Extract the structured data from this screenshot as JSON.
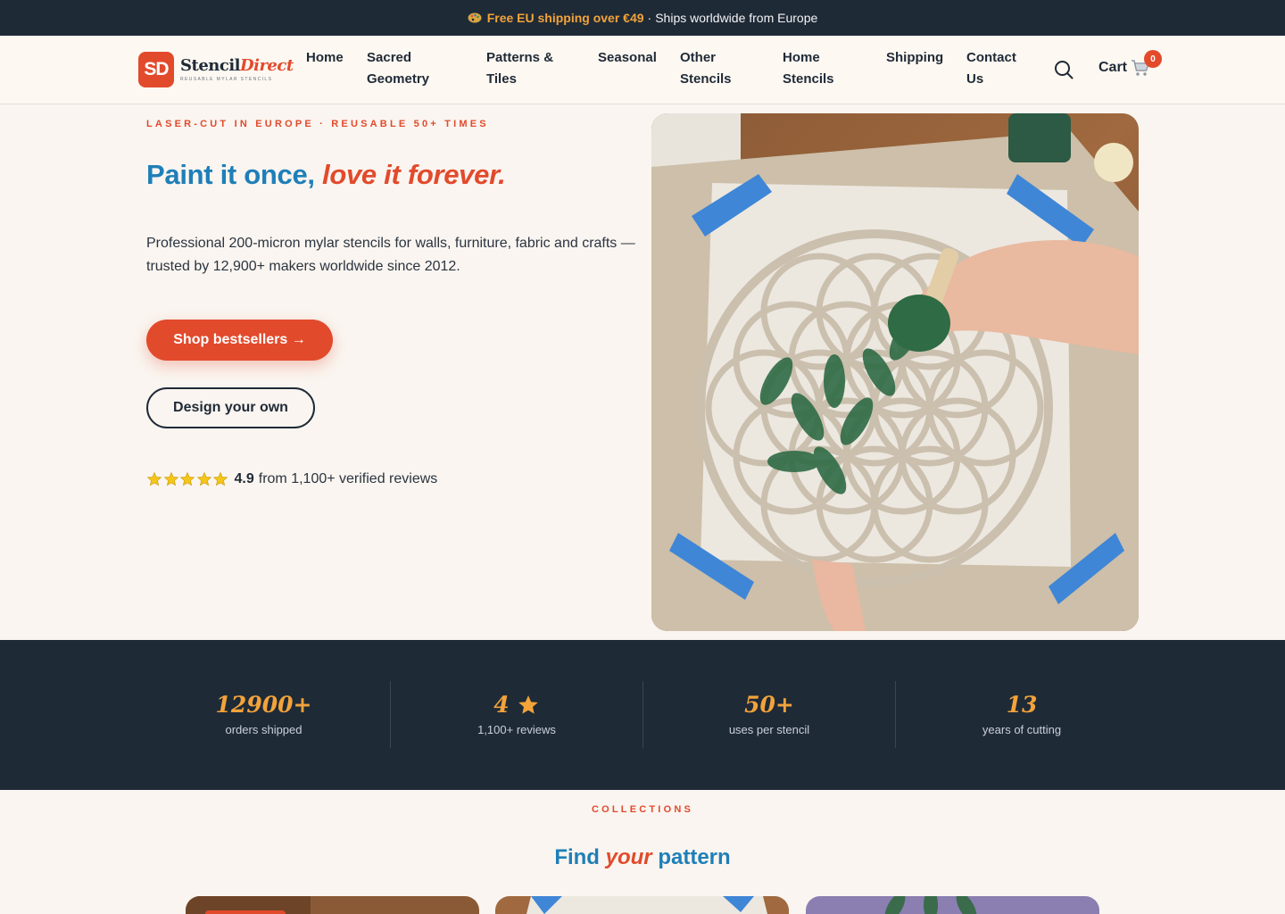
{
  "announcement": {
    "highlight": "Free EU shipping over €49",
    "separator": "·",
    "rest": "Ships worldwide from Europe"
  },
  "brand": {
    "mark": "SD",
    "name_part1": "Stencil",
    "name_part2": "Direct",
    "tagline": "Reusable Mylar Stencils",
    "accent_color": "#e24a2c",
    "blue_color": "#1f7fb8",
    "dark_color": "#1f2a37",
    "gold_color": "#f2a33a"
  },
  "nav": {
    "items": [
      {
        "line1": "Home",
        "line2": ""
      },
      {
        "line1": "Sacred",
        "line2": "Geometry"
      },
      {
        "line1": "Patterns &",
        "line2": "Tiles"
      },
      {
        "line1": "Seasonal",
        "line2": ""
      },
      {
        "line1": "Other",
        "line2": "Stencils"
      },
      {
        "line1": "Home",
        "line2": "Stencils"
      },
      {
        "line1": "Shipping",
        "line2": ""
      },
      {
        "line1": "Contact",
        "line2": "Us"
      }
    ],
    "cart_label": "Cart",
    "cart_count": "0"
  },
  "hero": {
    "eyebrow": "LASER-CUT IN EUROPE · REUSABLE 50+ TIMES",
    "title_plain": "Paint it once, ",
    "title_em": "love it forever.",
    "subtitle": "Professional 200-micron mylar stencils for walls, furniture, fabric and crafts — trusted by 12,900+ makers worldwide since 2012.",
    "primary_button": "Shop bestsellers →",
    "secondary_button": "Design your own",
    "rating_score": "4.9",
    "rating_text": "from 1,100+ verified reviews",
    "rating_stars": 5
  },
  "stats": [
    {
      "value": "12900+",
      "label": "orders shipped"
    },
    {
      "value": "4",
      "label": "1,100+ reviews",
      "icon": "star-icon"
    },
    {
      "value": "50+",
      "label": "uses per stencil"
    },
    {
      "value": "13",
      "label": "years of cutting"
    }
  ],
  "collections": {
    "eyebrow": "COLLECTIONS",
    "title_a": "Find ",
    "title_em": "your",
    "title_b": " pattern"
  }
}
